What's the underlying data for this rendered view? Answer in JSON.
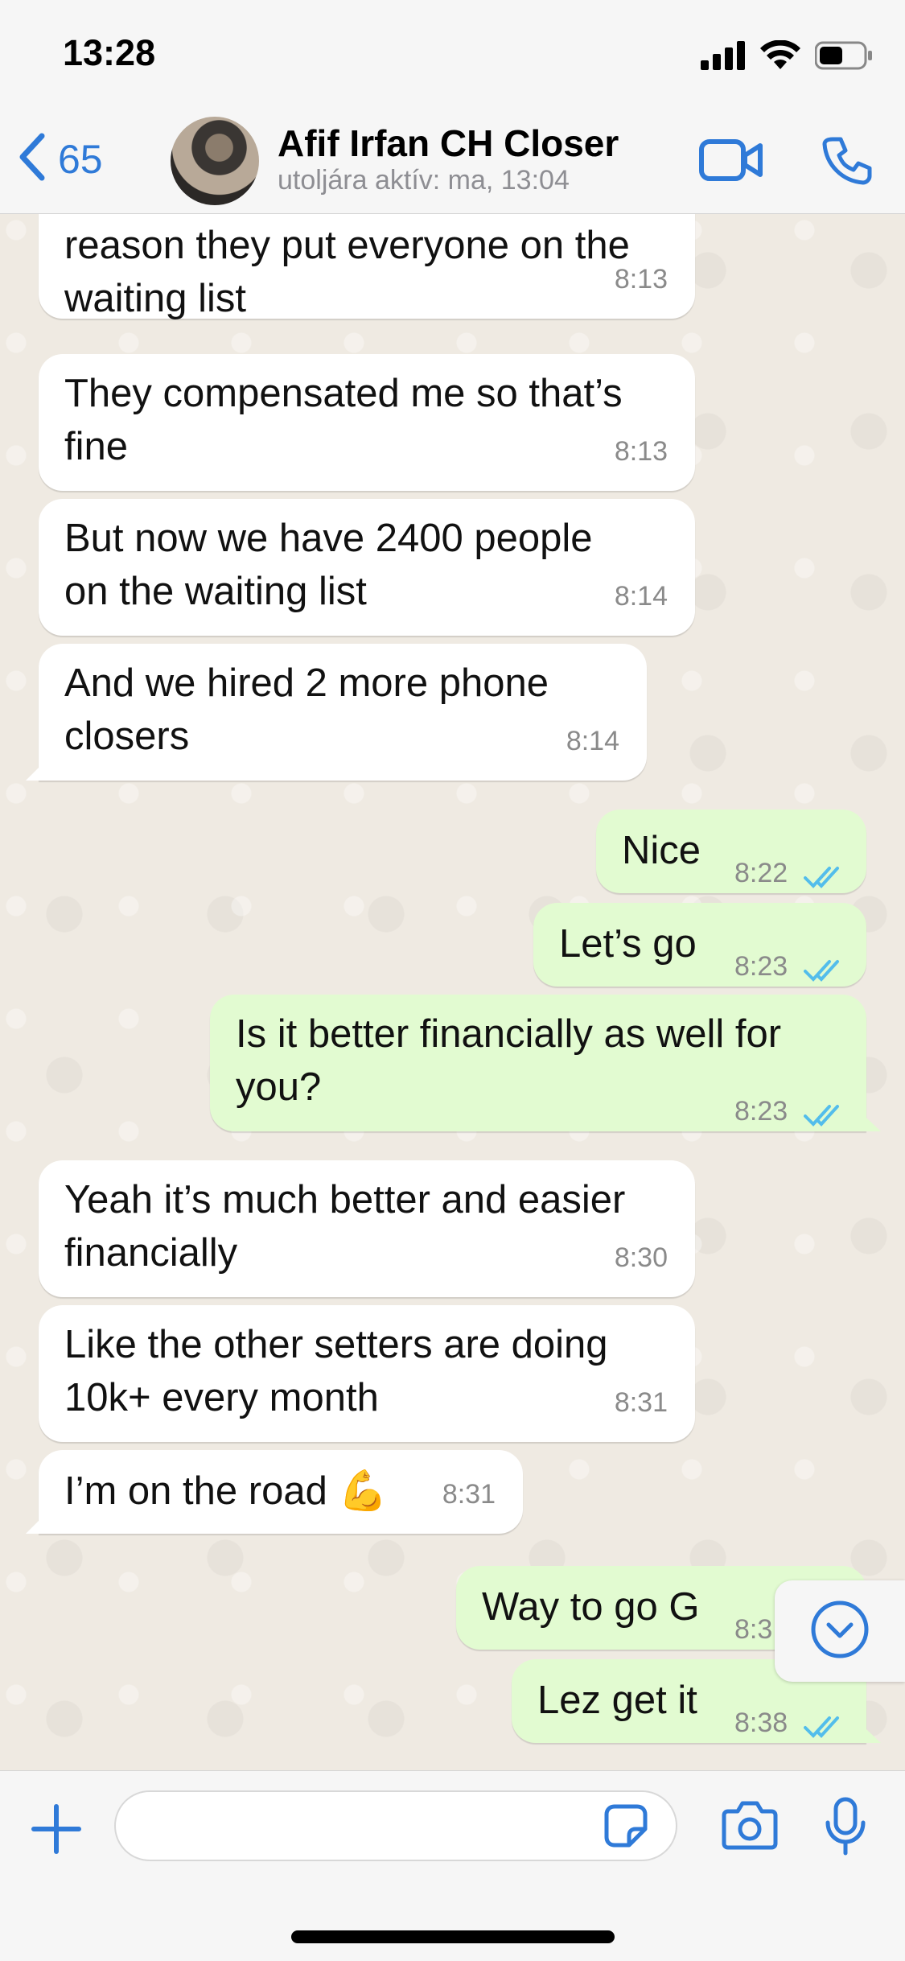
{
  "status_bar": {
    "time": "13:28"
  },
  "header": {
    "back_count": "65",
    "contact_name": "Afif Irfan CH Closer",
    "last_seen": "utoljára aktív: ma, 13:04"
  },
  "messages": [
    {
      "dir": "in",
      "text_lines": [
        "reason they put everyone on the",
        "waiting list"
      ],
      "time": "8:13"
    },
    {
      "dir": "in",
      "text_lines": [
        "They compensated me so that’s",
        "fine"
      ],
      "time": "8:13"
    },
    {
      "dir": "in",
      "text_lines": [
        "But now we have 2400 people",
        "on the waiting list"
      ],
      "time": "8:14"
    },
    {
      "dir": "in",
      "text_lines": [
        "And we hired 2 more phone",
        "closers"
      ],
      "time": "8:14"
    },
    {
      "dir": "out",
      "text": "Nice",
      "time": "8:22"
    },
    {
      "dir": "out",
      "text": "Let’s go",
      "time": "8:23"
    },
    {
      "dir": "out",
      "text_lines": [
        "Is it better financially as well for",
        "you?"
      ],
      "time": "8:23"
    },
    {
      "dir": "in",
      "text_lines": [
        "Yeah it’s much better and easier",
        "financially"
      ],
      "time": "8:30"
    },
    {
      "dir": "in",
      "text_lines": [
        "Like the other setters are doing",
        "10k+ every month"
      ],
      "time": "8:31"
    },
    {
      "dir": "in",
      "text": "I’m on the road 💪",
      "time": "8:31"
    },
    {
      "dir": "out",
      "text": "Way to go G",
      "time": "8:3"
    },
    {
      "dir": "out",
      "text": "Lez get it",
      "time": "8:38"
    }
  ],
  "input": {
    "placeholder": ""
  },
  "colors": {
    "accent": "#2f7ad8",
    "outgoing_bubble": "#e2fbd1",
    "read_ticks": "#53bdeb"
  }
}
